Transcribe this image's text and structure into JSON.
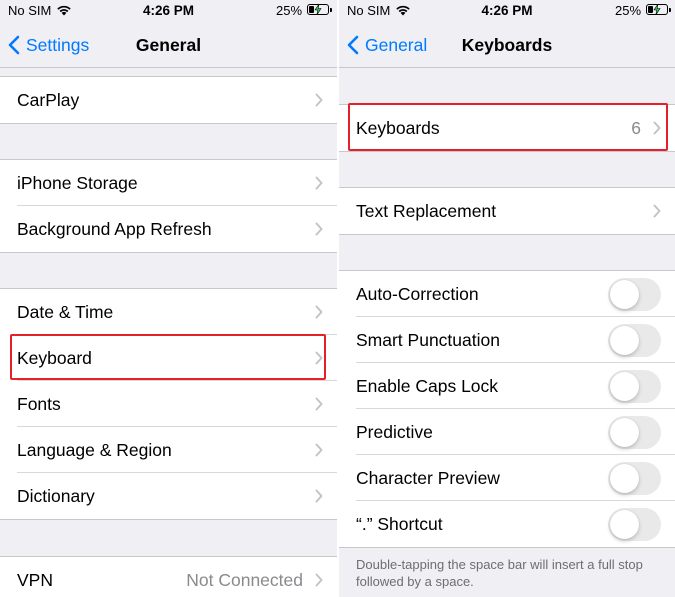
{
  "status_bar": {
    "carrier": "No SIM",
    "time": "4:26 PM",
    "battery": "25%"
  },
  "left": {
    "back_label": "Settings",
    "title": "General",
    "rows": [
      {
        "label": "CarPlay"
      },
      {
        "label": "iPhone Storage"
      },
      {
        "label": "Background App Refresh"
      },
      {
        "label": "Date & Time"
      },
      {
        "label": "Keyboard"
      },
      {
        "label": "Fonts"
      },
      {
        "label": "Language & Region"
      },
      {
        "label": "Dictionary"
      },
      {
        "label": "VPN",
        "value": "Not Connected"
      }
    ]
  },
  "right": {
    "back_label": "General",
    "title": "Keyboards",
    "keyboards": {
      "label": "Keyboards",
      "value": "6"
    },
    "text_replacement": {
      "label": "Text Replacement"
    },
    "toggles": [
      {
        "label": "Auto-Correction",
        "on": false
      },
      {
        "label": "Smart Punctuation",
        "on": false
      },
      {
        "label": "Enable Caps Lock",
        "on": false
      },
      {
        "label": "Predictive",
        "on": false
      },
      {
        "label": "Character Preview",
        "on": false
      },
      {
        "label": "“.” Shortcut",
        "on": false
      }
    ],
    "footer": "Double-tapping the space bar will insert a full stop followed by a space."
  },
  "colors": {
    "accent": "#007aff",
    "highlight": "#e5202a",
    "background": "#efeff4",
    "toggle_off": "#e9e9ea"
  }
}
